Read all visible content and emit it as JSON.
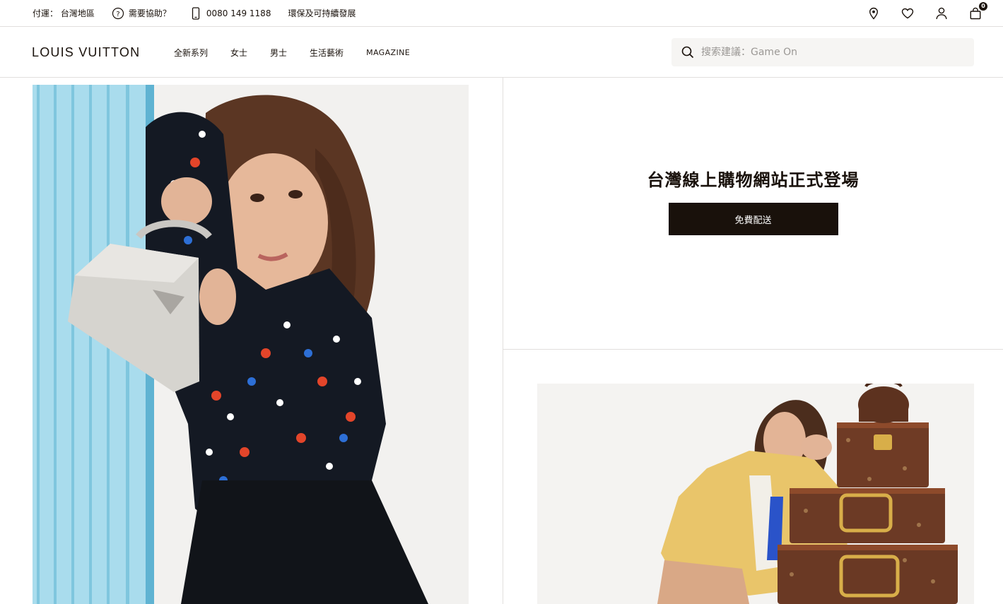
{
  "utility": {
    "ship_to": "付運： 台灣地區",
    "help": "需要協助？",
    "phone": "0080 149 1188",
    "sustainability": "環保及可持續發展",
    "cart_count": "0"
  },
  "header": {
    "logo": "LOUIS VUITTON",
    "nav": [
      "全新系列",
      "女士",
      "男士",
      "生活藝術",
      "MAGAZINE"
    ],
    "search_placeholder": "搜索建議：Game On"
  },
  "promo": {
    "title": "台灣線上購物網站正式登場",
    "button": "免費配送"
  },
  "colors": {
    "text": "#19110b",
    "button_bg": "#19110b",
    "search_bg": "#f6f5f3",
    "divider": "#e1dfdd"
  }
}
